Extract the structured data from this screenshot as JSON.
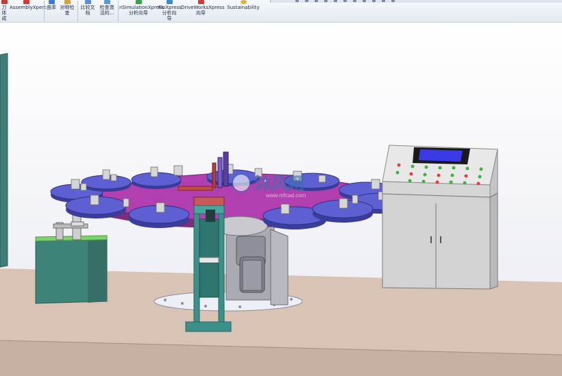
{
  "ribbon": {
    "buttons": [
      {
        "label": "刀体\n成",
        "icon_color": "#c43b3b"
      },
      {
        "label": "AssemblyXpert",
        "icon_color": "#d23a3a"
      },
      {
        "label": "曲率",
        "icon_color": "#3b7bd2"
      },
      {
        "label": "对称检\n查",
        "icon_color": "#d2a23b"
      },
      {
        "label": "比较文\n档",
        "icon_color": "#5b8bd2"
      },
      {
        "label": "检查激\n活的...",
        "icon_color": "#5b9bd2"
      },
      {
        "label": "nSimulationXpress\n分析向导",
        "icon_color": "#3ba24a"
      },
      {
        "label": "FloXpress\n分析向\n导",
        "icon_color": "#3b8bd2"
      },
      {
        "label": "DriveWorksXpress\n向导",
        "icon_color": "#d23a3a"
      },
      {
        "label": "Sustainability",
        "icon_color": "#e0b030"
      }
    ]
  },
  "view_toolbar": {
    "icons": [
      "zoom-to-fit-icon",
      "zoom-area-icon",
      "previous-view-icon",
      "section-view-icon",
      "view-orientation-icon",
      "display-style-icon",
      "hide-show-icon",
      "edit-appearance-icon",
      "apply-scene-icon",
      "view-settings-icon"
    ]
  },
  "watermark": {
    "text": "沐风网",
    "url": "www.mfcad.com"
  },
  "colors": {
    "floor": "#d9c3b5",
    "turntable": "#b23fb0",
    "plates": "#5d5fd2",
    "cabinet": "#d2d2d2",
    "teal": "#3d8f8a",
    "green_box": "#3e8377",
    "lcd": "#3a3ae6"
  }
}
